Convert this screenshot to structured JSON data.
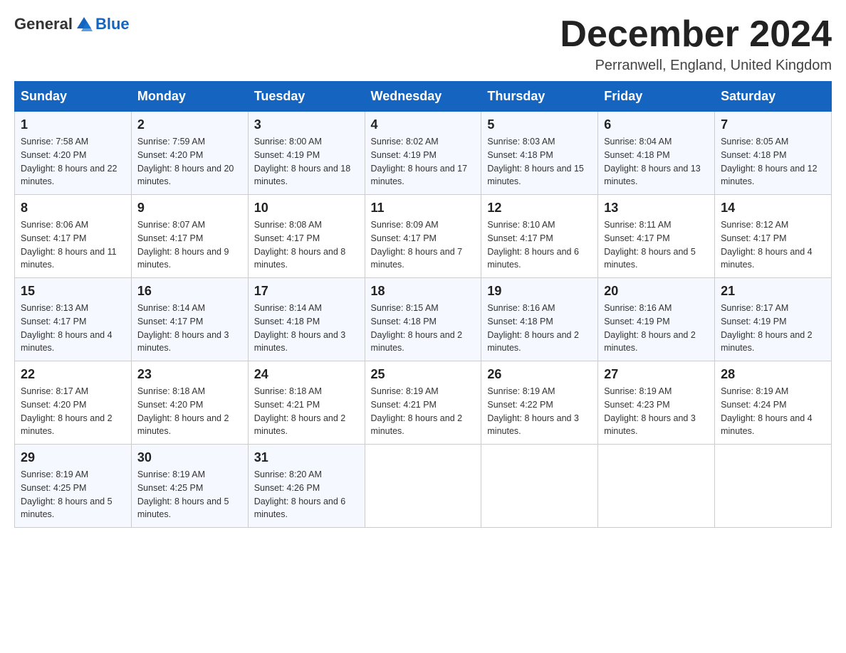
{
  "header": {
    "logo": {
      "text_general": "General",
      "text_blue": "Blue"
    },
    "title": "December 2024",
    "location": "Perranwell, England, United Kingdom"
  },
  "days_of_week": [
    "Sunday",
    "Monday",
    "Tuesday",
    "Wednesday",
    "Thursday",
    "Friday",
    "Saturday"
  ],
  "weeks": [
    [
      {
        "day": "1",
        "sunrise": "7:58 AM",
        "sunset": "4:20 PM",
        "daylight": "8 hours and 22 minutes."
      },
      {
        "day": "2",
        "sunrise": "7:59 AM",
        "sunset": "4:20 PM",
        "daylight": "8 hours and 20 minutes."
      },
      {
        "day": "3",
        "sunrise": "8:00 AM",
        "sunset": "4:19 PM",
        "daylight": "8 hours and 18 minutes."
      },
      {
        "day": "4",
        "sunrise": "8:02 AM",
        "sunset": "4:19 PM",
        "daylight": "8 hours and 17 minutes."
      },
      {
        "day": "5",
        "sunrise": "8:03 AM",
        "sunset": "4:18 PM",
        "daylight": "8 hours and 15 minutes."
      },
      {
        "day": "6",
        "sunrise": "8:04 AM",
        "sunset": "4:18 PM",
        "daylight": "8 hours and 13 minutes."
      },
      {
        "day": "7",
        "sunrise": "8:05 AM",
        "sunset": "4:18 PM",
        "daylight": "8 hours and 12 minutes."
      }
    ],
    [
      {
        "day": "8",
        "sunrise": "8:06 AM",
        "sunset": "4:17 PM",
        "daylight": "8 hours and 11 minutes."
      },
      {
        "day": "9",
        "sunrise": "8:07 AM",
        "sunset": "4:17 PM",
        "daylight": "8 hours and 9 minutes."
      },
      {
        "day": "10",
        "sunrise": "8:08 AM",
        "sunset": "4:17 PM",
        "daylight": "8 hours and 8 minutes."
      },
      {
        "day": "11",
        "sunrise": "8:09 AM",
        "sunset": "4:17 PM",
        "daylight": "8 hours and 7 minutes."
      },
      {
        "day": "12",
        "sunrise": "8:10 AM",
        "sunset": "4:17 PM",
        "daylight": "8 hours and 6 minutes."
      },
      {
        "day": "13",
        "sunrise": "8:11 AM",
        "sunset": "4:17 PM",
        "daylight": "8 hours and 5 minutes."
      },
      {
        "day": "14",
        "sunrise": "8:12 AM",
        "sunset": "4:17 PM",
        "daylight": "8 hours and 4 minutes."
      }
    ],
    [
      {
        "day": "15",
        "sunrise": "8:13 AM",
        "sunset": "4:17 PM",
        "daylight": "8 hours and 4 minutes."
      },
      {
        "day": "16",
        "sunrise": "8:14 AM",
        "sunset": "4:17 PM",
        "daylight": "8 hours and 3 minutes."
      },
      {
        "day": "17",
        "sunrise": "8:14 AM",
        "sunset": "4:18 PM",
        "daylight": "8 hours and 3 minutes."
      },
      {
        "day": "18",
        "sunrise": "8:15 AM",
        "sunset": "4:18 PM",
        "daylight": "8 hours and 2 minutes."
      },
      {
        "day": "19",
        "sunrise": "8:16 AM",
        "sunset": "4:18 PM",
        "daylight": "8 hours and 2 minutes."
      },
      {
        "day": "20",
        "sunrise": "8:16 AM",
        "sunset": "4:19 PM",
        "daylight": "8 hours and 2 minutes."
      },
      {
        "day": "21",
        "sunrise": "8:17 AM",
        "sunset": "4:19 PM",
        "daylight": "8 hours and 2 minutes."
      }
    ],
    [
      {
        "day": "22",
        "sunrise": "8:17 AM",
        "sunset": "4:20 PM",
        "daylight": "8 hours and 2 minutes."
      },
      {
        "day": "23",
        "sunrise": "8:18 AM",
        "sunset": "4:20 PM",
        "daylight": "8 hours and 2 minutes."
      },
      {
        "day": "24",
        "sunrise": "8:18 AM",
        "sunset": "4:21 PM",
        "daylight": "8 hours and 2 minutes."
      },
      {
        "day": "25",
        "sunrise": "8:19 AM",
        "sunset": "4:21 PM",
        "daylight": "8 hours and 2 minutes."
      },
      {
        "day": "26",
        "sunrise": "8:19 AM",
        "sunset": "4:22 PM",
        "daylight": "8 hours and 3 minutes."
      },
      {
        "day": "27",
        "sunrise": "8:19 AM",
        "sunset": "4:23 PM",
        "daylight": "8 hours and 3 minutes."
      },
      {
        "day": "28",
        "sunrise": "8:19 AM",
        "sunset": "4:24 PM",
        "daylight": "8 hours and 4 minutes."
      }
    ],
    [
      {
        "day": "29",
        "sunrise": "8:19 AM",
        "sunset": "4:25 PM",
        "daylight": "8 hours and 5 minutes."
      },
      {
        "day": "30",
        "sunrise": "8:19 AM",
        "sunset": "4:25 PM",
        "daylight": "8 hours and 5 minutes."
      },
      {
        "day": "31",
        "sunrise": "8:20 AM",
        "sunset": "4:26 PM",
        "daylight": "8 hours and 6 minutes."
      },
      null,
      null,
      null,
      null
    ]
  ]
}
